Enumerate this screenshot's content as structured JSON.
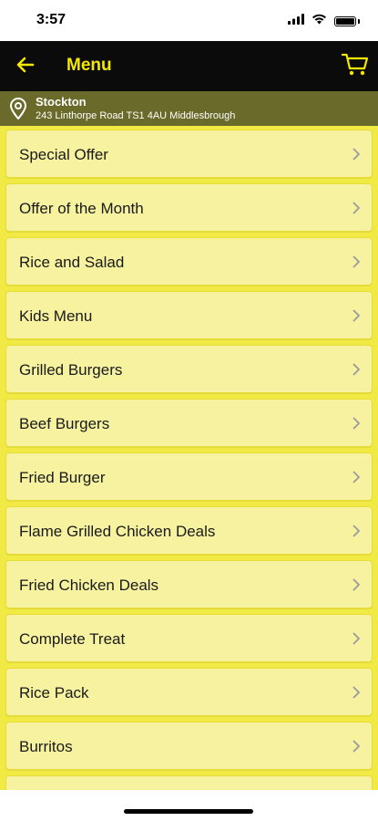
{
  "status": {
    "time": "3:57"
  },
  "header": {
    "title": "Menu"
  },
  "location": {
    "name": "Stockton",
    "address": "243 Linthorpe Road TS1 4AU Middlesbrough"
  },
  "menu": {
    "items": [
      {
        "label": "Special Offer"
      },
      {
        "label": "Offer of the Month"
      },
      {
        "label": "Rice and Salad"
      },
      {
        "label": "Kids Menu"
      },
      {
        "label": "Grilled Burgers"
      },
      {
        "label": "Beef Burgers"
      },
      {
        "label": "Fried Burger"
      },
      {
        "label": "Flame Grilled Chicken Deals"
      },
      {
        "label": "Fried Chicken Deals"
      },
      {
        "label": "Complete Treat"
      },
      {
        "label": "Rice Pack"
      },
      {
        "label": "Burritos"
      },
      {
        "label": ""
      }
    ]
  },
  "icons": {
    "back": "arrow-left-icon",
    "cart": "shopping-cart-icon",
    "pin": "location-pin-icon",
    "chevron": "chevron-right-icon"
  },
  "colors": {
    "accent": "#f5e800",
    "nav_bg": "#0b0b0b",
    "location_bg": "#6a6a2a",
    "list_bg": "#f1ea45",
    "item_bg": "#f7f2a0"
  }
}
